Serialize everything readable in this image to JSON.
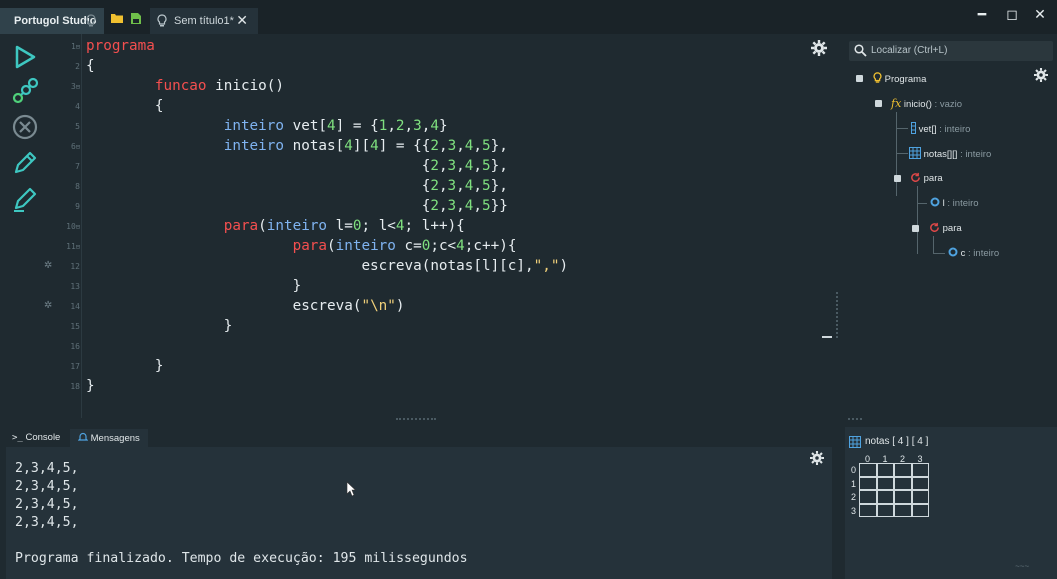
{
  "titlebar": {
    "app_name": "Portugol Studio",
    "doc_tab": "Sem título1*",
    "close": "✕",
    "minimize": "━",
    "maximize": "◻",
    "close_window": "✕"
  },
  "editor": {
    "line_numbers": [
      "1",
      "2",
      "3",
      "4",
      "5",
      "6",
      "7",
      "8",
      "9",
      "10",
      "11",
      "12",
      "13",
      "14",
      "15",
      "16",
      "17",
      "18"
    ],
    "fold_lines": [
      "1",
      "3",
      "6",
      "10",
      "11"
    ],
    "breakpoint_lines": [
      "12",
      "14"
    ]
  },
  "tree": {
    "root": "Programa",
    "func_name": "inicio()",
    "func_type": " : vazio",
    "vet_name": "vet[]",
    "vet_type": " : inteiro",
    "notas_name": "notas[][]",
    "notas_type": " : inteiro",
    "para1": "para",
    "l_name": "l",
    "l_type": " : inteiro",
    "para2": "para",
    "c_name": "c",
    "c_type": " : inteiro"
  },
  "search": {
    "placeholder": "Localizar (Ctrl+L)"
  },
  "bottom_tabs": {
    "console": "Console",
    "mensagens": "Mensagens"
  },
  "console": {
    "output": "2,3,4,5,\n2,3,4,5,\n2,3,4,5,\n2,3,4,5,\n\nPrograma finalizado. Tempo de execução: 195 milissegundos"
  },
  "matrix": {
    "title": "notas  [ 4 ] [ 4 ]",
    "cols": [
      "0",
      "1",
      "2",
      "3"
    ],
    "rows": [
      "0",
      "1",
      "2",
      "3"
    ]
  },
  "colors": {
    "keyword_red": "#f44f4f",
    "keyword_blue": "#7fb3f0",
    "number_green": "#7fe07f",
    "string_yellow": "#f0d07a",
    "bg": "#1f2a30"
  }
}
